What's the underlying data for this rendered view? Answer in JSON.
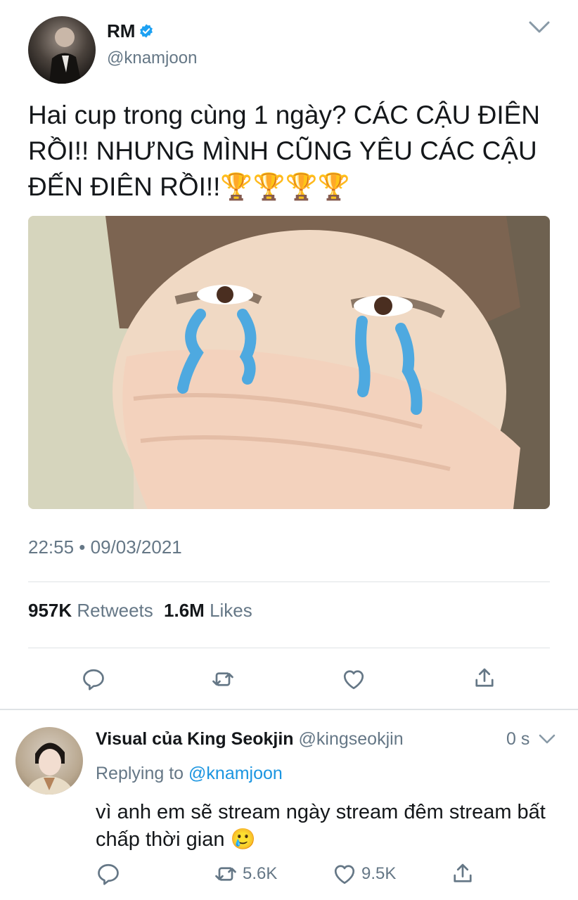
{
  "tweet": {
    "author_name": "RM",
    "handle": "@knamjoon",
    "text": "Hai cup trong cùng 1 ngày? CÁC CẬU ĐIÊN RỒI!! NHƯNG MÌNH CŨNG YÊU CÁC CẬU ĐẾN ĐIÊN RỒI!!🏆🏆🏆🏆",
    "timestamp": "22:55 • 09/03/2021",
    "retweets_count": "957K",
    "retweets_label": "Retweets",
    "likes_count": "1.6M",
    "likes_label": "Likes"
  },
  "reply": {
    "author_name": "Visual của King Seokjin",
    "handle": "@kingseokjin",
    "time": "0 s",
    "replying_to_label": "Replying to",
    "replying_to_handle": "@knamjoon",
    "text": "vì anh em sẽ stream ngày stream đêm stream bất chấp thời gian 🥲",
    "retweets": "5.6K",
    "likes": "9.5K"
  },
  "colors": {
    "link": "#1b95e0",
    "muted": "#657786",
    "divider": "#dfe3e6",
    "verified": "#1da1f2"
  },
  "icons": [
    "verified-badge-icon",
    "chevron-down-icon",
    "reply-icon",
    "retweet-icon",
    "like-icon",
    "share-icon"
  ]
}
